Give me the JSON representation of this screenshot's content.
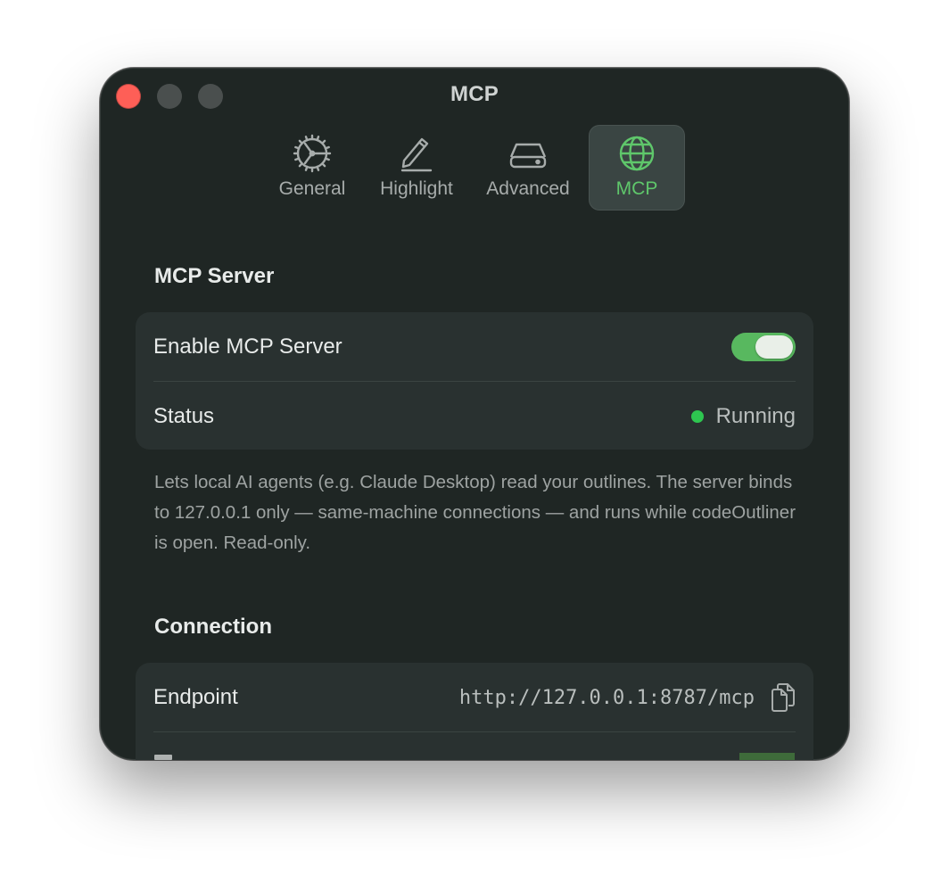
{
  "window": {
    "title": "MCP"
  },
  "toolbar": {
    "tabs": [
      {
        "label": "General",
        "icon": "gear-icon",
        "active": false
      },
      {
        "label": "Highlight",
        "icon": "pencil-icon",
        "active": false
      },
      {
        "label": "Advanced",
        "icon": "drive-icon",
        "active": false
      },
      {
        "label": "MCP",
        "icon": "globe-icon",
        "active": true
      }
    ]
  },
  "mcp_server": {
    "section_title": "MCP Server",
    "enable_label": "Enable MCP Server",
    "enabled": true,
    "status_label": "Status",
    "status_value": "Running",
    "description": "Lets local AI agents (e.g. Claude Desktop) read your outlines. The server binds to 127.0.0.1 only — same-machine connections — and runs while codeOutliner is open. Read-only."
  },
  "connection": {
    "section_title": "Connection",
    "endpoint_label": "Endpoint",
    "endpoint_value": "http://127.0.0.1:8787/mcp"
  },
  "colors": {
    "accent": "#5fc76b",
    "toggle_on": "#58b85f",
    "status_running": "#2ec650",
    "close_button": "#fe5f57",
    "window_bg": "#1f2624",
    "group_bg": "#293130"
  }
}
